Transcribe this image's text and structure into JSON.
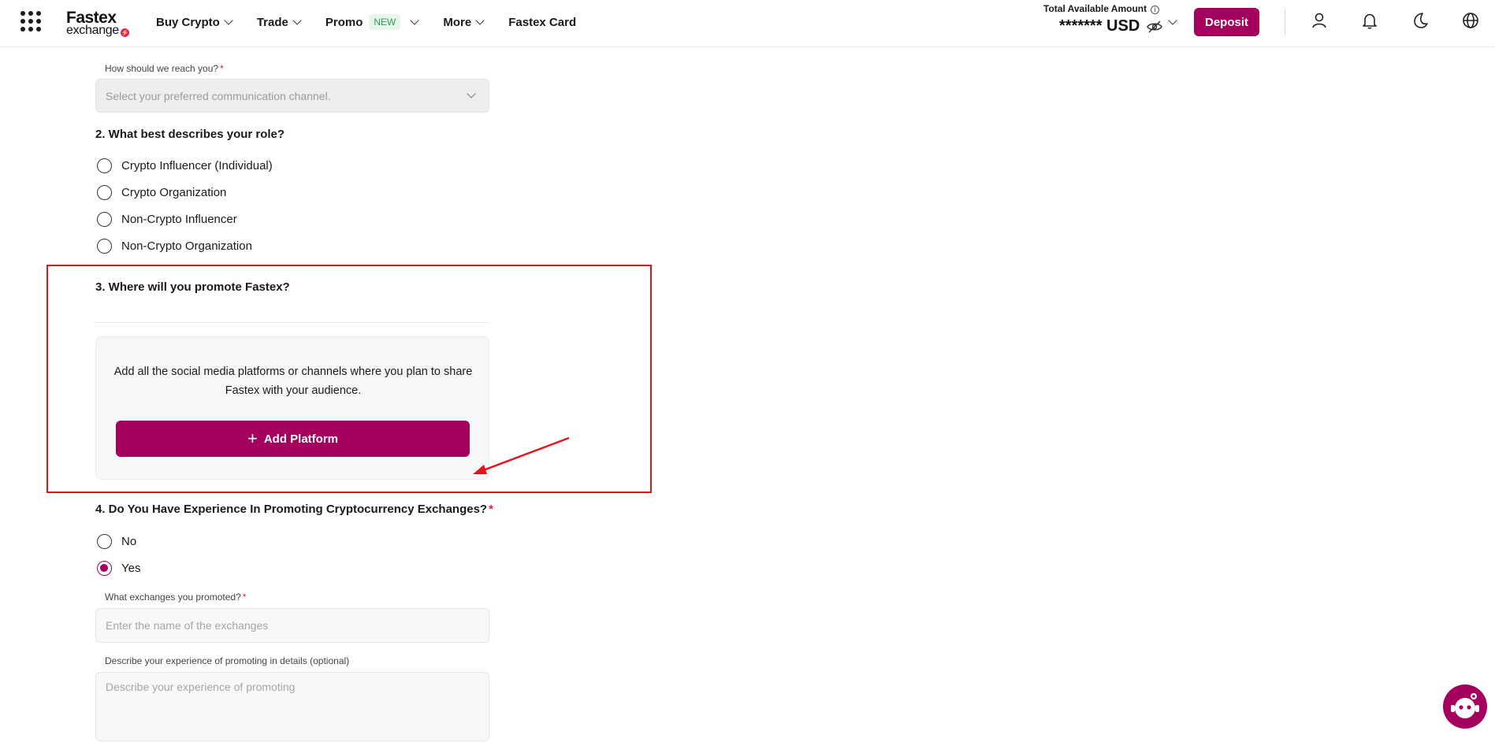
{
  "header": {
    "logo_line1": "Fastex",
    "logo_line2": "exchange",
    "nav": [
      {
        "label": "Buy Crypto"
      },
      {
        "label": "Trade"
      },
      {
        "label": "Promo",
        "badge": "NEW"
      },
      {
        "label": "More"
      },
      {
        "label": "Fastex Card"
      }
    ],
    "balance_label": "Total Available Amount",
    "balance_value": "******* USD",
    "deposit_label": "Deposit"
  },
  "form": {
    "contact": {
      "label": "How should we reach you?",
      "required_mark": "*",
      "placeholder": "Select your preferred communication channel."
    },
    "q2": {
      "title": "2. What best describes your role?",
      "options": [
        "Crypto Influencer (Individual)",
        "Crypto Organization",
        "Non-Crypto Influencer",
        "Non-Crypto Organization"
      ]
    },
    "q3": {
      "title": "3. Where will you promote Fastex?",
      "description": "Add all the social media platforms or channels where you plan to share Fastex with your audience.",
      "add_button": "Add Platform"
    },
    "q4": {
      "title": "4. Do You Have Experience In Promoting Cryptocurrency Exchanges?",
      "required_mark": "*",
      "options": [
        "No",
        "Yes"
      ],
      "selected": "Yes"
    },
    "exchanges": {
      "label": "What exchanges you promoted?",
      "required_mark": "*",
      "placeholder": "Enter the name of the exchanges"
    },
    "experience": {
      "label": "Describe your experience of promoting in details (optional)",
      "placeholder": "Describe your experience of promoting"
    }
  },
  "colors": {
    "brand": "#a6005f",
    "annotation": "#e0161e"
  }
}
